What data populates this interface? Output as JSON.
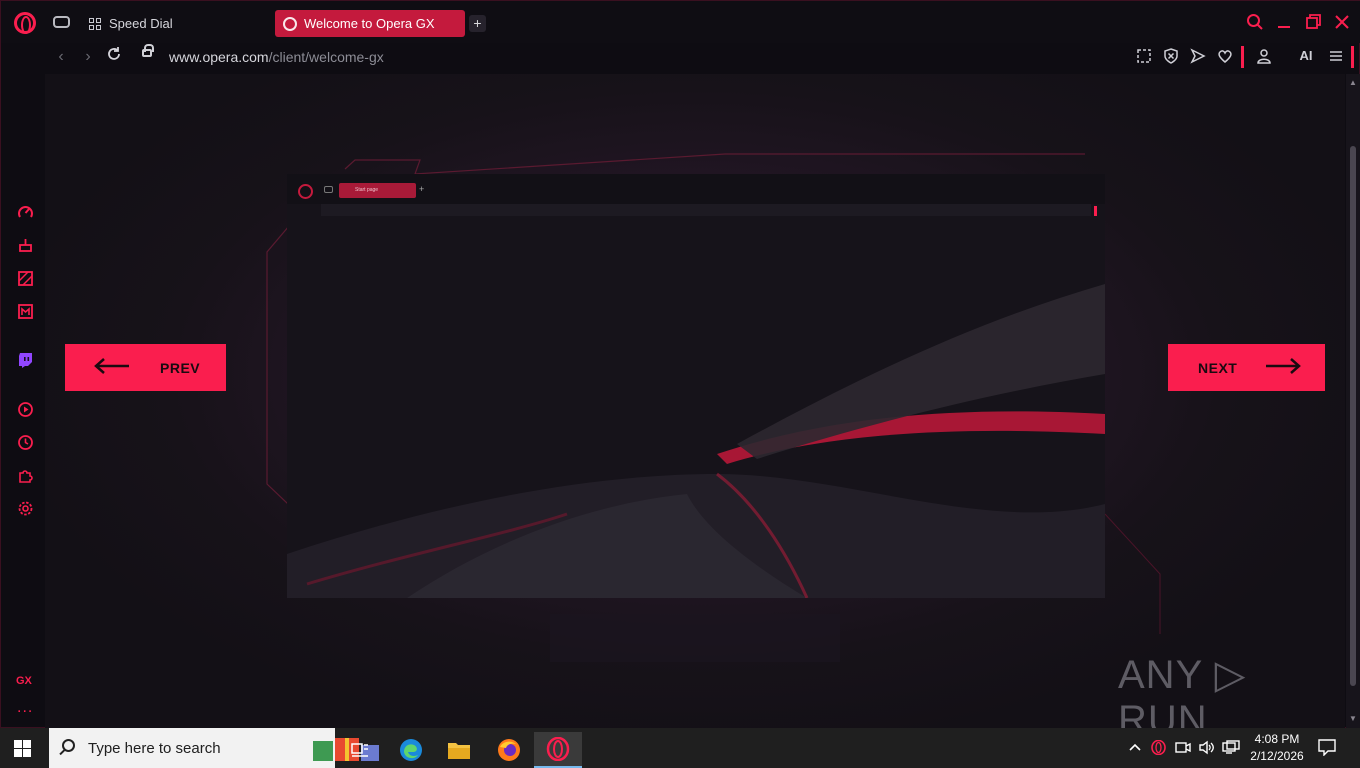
{
  "browser": {
    "tabs": [
      {
        "label": "Speed Dial",
        "active": false
      },
      {
        "label": "Welcome to Opera GX",
        "active": true
      }
    ],
    "new_tab_label": "+",
    "url": {
      "host": "www.opera.com",
      "path": "/client/welcome-gx"
    },
    "ai_label": "AI",
    "accent_color": "#fa1e4e",
    "sidebar_bottom_label": "GX",
    "sidebar_more_label": "..."
  },
  "welcome": {
    "prev_label": "PREV",
    "next_label": "NEXT",
    "preview_tab_label": "Start page"
  },
  "watermark": "ANY ▷ RUN",
  "taskbar": {
    "search_placeholder": "Type here to search",
    "time": "4:08 PM",
    "date": "2/12/2026"
  }
}
